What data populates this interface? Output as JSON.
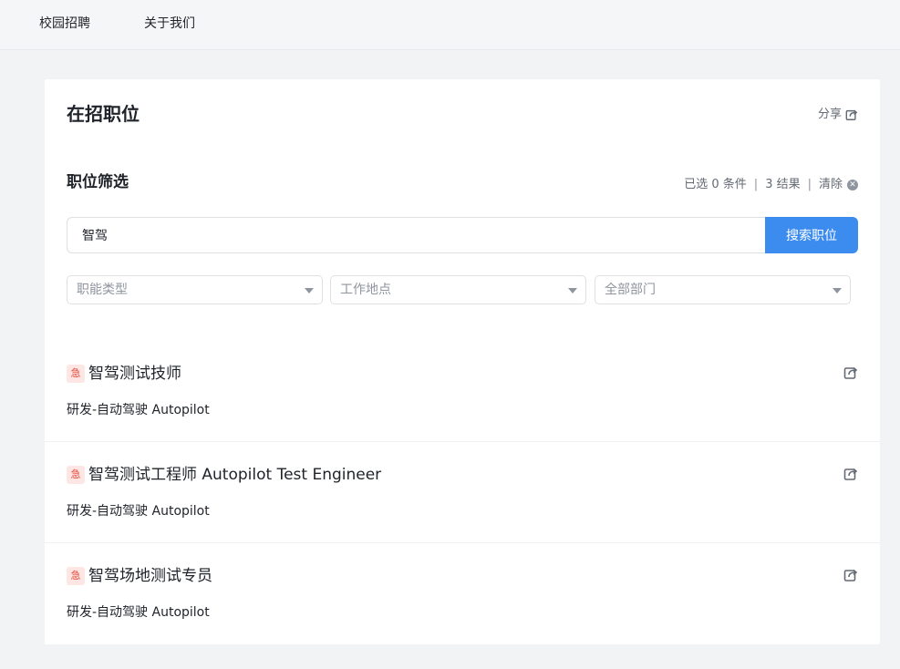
{
  "nav": {
    "items": [
      "校园招聘",
      "关于我们"
    ]
  },
  "page": {
    "title": "在招职位",
    "share_label": "分享"
  },
  "filter": {
    "title": "职位筛选",
    "selected_text": "已选 0 条件",
    "results_text": "3 结果",
    "clear_label": "清除",
    "separator": "|"
  },
  "search": {
    "value": "智驾",
    "button_label": "搜索职位"
  },
  "selects": [
    {
      "placeholder": "职能类型"
    },
    {
      "placeholder": "工作地点"
    },
    {
      "placeholder": "全部部门"
    }
  ],
  "jobs": [
    {
      "tag": "急",
      "title": "智驾测试技师",
      "dept": "研发-自动驾驶 Autopilot"
    },
    {
      "tag": "急",
      "title": "智驾测试工程师 Autopilot Test Engineer",
      "dept": "研发-自动驾驶 Autopilot"
    },
    {
      "tag": "急",
      "title": "智驾场地测试专员",
      "dept": "研发-自动驾驶 Autopilot"
    }
  ],
  "icons": {
    "share": "share-icon",
    "clear": "close-circle-icon",
    "caret": "chevron-down-icon"
  },
  "colors": {
    "primary": "#3c8cf0",
    "urgent_bg": "#fde6e3",
    "urgent_fg": "#e8483b"
  }
}
